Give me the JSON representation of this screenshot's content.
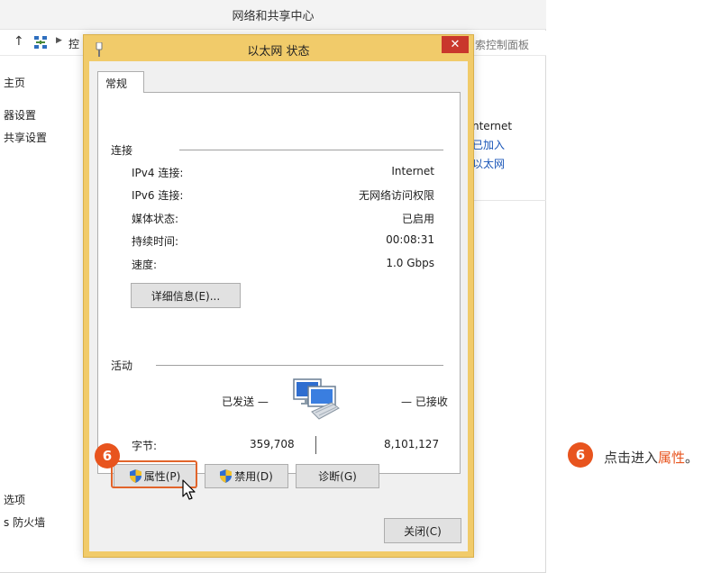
{
  "background_window": {
    "title": "网络和共享中心",
    "breadcrumb_fragment": "控",
    "search_placeholder_fragment": "索控制面板",
    "left_items": [
      "主页",
      "器设置",
      "共享设置",
      "选项",
      "s 防火墙"
    ],
    "right_texts": [
      "nternet",
      "已加入",
      "以太网"
    ]
  },
  "dialog": {
    "title": "以太网 状态",
    "close_glyph": "✕",
    "tab_label": "常规",
    "connection": {
      "group_label": "连接",
      "rows": [
        {
          "label": "IPv4 连接:",
          "value": "Internet"
        },
        {
          "label": "IPv6 连接:",
          "value": "无网络访问权限"
        },
        {
          "label": "媒体状态:",
          "value": "已启用"
        },
        {
          "label": "持续时间:",
          "value": "00:08:31"
        },
        {
          "label": "速度:",
          "value": "1.0 Gbps"
        }
      ],
      "details_button": "详细信息(E)..."
    },
    "activity": {
      "group_label": "活动",
      "sent_label": "已发送 —",
      "received_label": "— 已接收",
      "bytes_label": "字节:",
      "bytes_sent": "359,708",
      "bytes_received": "8,101,127"
    },
    "buttons": {
      "properties": "属性(P)",
      "disable": "禁用(D)",
      "diagnose": "诊断(G)",
      "close": "关闭(C)"
    }
  },
  "annotation": {
    "step_number": "6",
    "instruction_prefix": "点击进入",
    "instruction_highlight": "属性",
    "instruction_suffix": "。",
    "accent_color": "#e8541e"
  }
}
